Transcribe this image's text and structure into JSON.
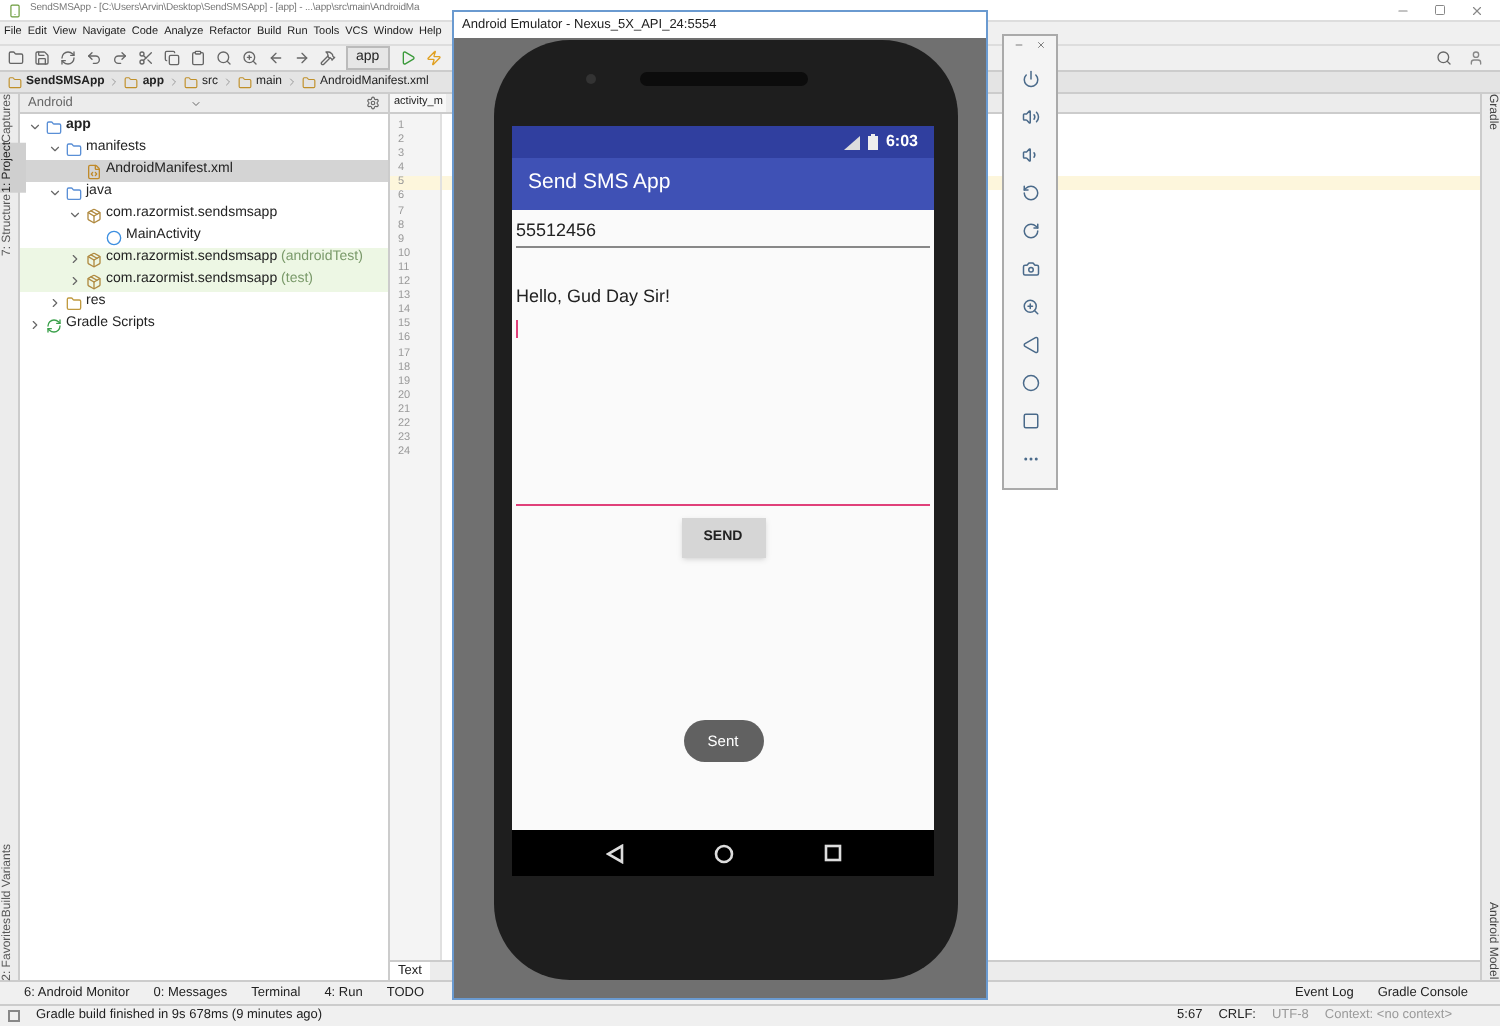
{
  "ide": {
    "title": "SendSMSApp - [C:\\Users\\Arvin\\Desktop\\SendSMSApp] - [app] - ...\\app\\src\\main\\AndroidMa",
    "menu": [
      "File",
      "Edit",
      "View",
      "Navigate",
      "Code",
      "Analyze",
      "Refactor",
      "Build",
      "Run",
      "Tools",
      "VCS",
      "Window",
      "Help"
    ],
    "run_config": "app",
    "breadcrumb": [
      "SendSMSApp",
      "app",
      "src",
      "main",
      "AndroidManifest.xml"
    ],
    "left_strip": [
      {
        "label": "Captures",
        "selected": false
      },
      {
        "label": "1: Project",
        "selected": true
      },
      {
        "label": "7: Structure",
        "selected": false
      },
      {
        "label": "Build Variants",
        "selected": false
      },
      {
        "label": "2: Favorites",
        "selected": false
      }
    ],
    "right_strip": [
      "Gradle",
      "Android Model"
    ],
    "project_view": "Android",
    "tree": [
      {
        "kind": "module",
        "name": "app",
        "expanded": true,
        "selected": false,
        "test": false,
        "children": [
          {
            "kind": "folder",
            "name": "manifests",
            "expanded": true,
            "selected": false,
            "test": false,
            "children": [
              {
                "kind": "manifest",
                "name": "AndroidManifest.xml",
                "selected": true,
                "test": false
              }
            ]
          },
          {
            "kind": "folder",
            "name": "java",
            "expanded": true,
            "selected": false,
            "test": false,
            "children": [
              {
                "kind": "package",
                "name": "com.razormist.sendsmsapp",
                "expanded": true,
                "selected": false,
                "test": false,
                "children": [
                  {
                    "kind": "class",
                    "name": "MainActivity",
                    "selected": false,
                    "test": false
                  }
                ]
              },
              {
                "kind": "package",
                "name": "com.razormist.sendsmsapp",
                "suffix": "(androidTest)",
                "expanded": false,
                "selected": false,
                "test": true
              },
              {
                "kind": "package",
                "name": "com.razormist.sendsmsapp",
                "suffix": "(test)",
                "expanded": false,
                "selected": false,
                "test": true
              }
            ]
          },
          {
            "kind": "res",
            "name": "res",
            "expanded": false,
            "selected": false,
            "test": false
          }
        ]
      },
      {
        "kind": "gradle",
        "name": "Gradle Scripts",
        "expanded": false,
        "selected": false,
        "test": false
      }
    ],
    "editor_tab": "activity_m",
    "line_numbers": [
      "1",
      "2",
      "3",
      "4",
      "5",
      "6",
      "7",
      "8",
      "9",
      "10",
      "11",
      "12",
      "13",
      "14",
      "15",
      "16",
      "17",
      "18",
      "19",
      "20",
      "21",
      "22",
      "23",
      "24"
    ],
    "editor_bottom_tab": "Text",
    "tool_tabs": [
      "6: Android Monitor",
      "0: Messages",
      "Terminal",
      "4: Run",
      "TODO"
    ],
    "tool_tabs_right": [
      "Event Log",
      "Gradle Console"
    ],
    "status": "Gradle build finished in 9s 678ms (9 minutes ago)",
    "status_right": [
      "5:67",
      "CRLF:",
      "UTF-8",
      "Context: <no context>"
    ]
  },
  "emulator": {
    "title": "Android Emulator - Nexus_5X_API_24:5554",
    "time": "6:03",
    "app_title": "Send SMS App",
    "phone_field": {
      "value": "55512456"
    },
    "message_field": {
      "value": "Hello, Gud Day Sir!"
    },
    "send_button": "SEND",
    "toast": "Sent"
  }
}
